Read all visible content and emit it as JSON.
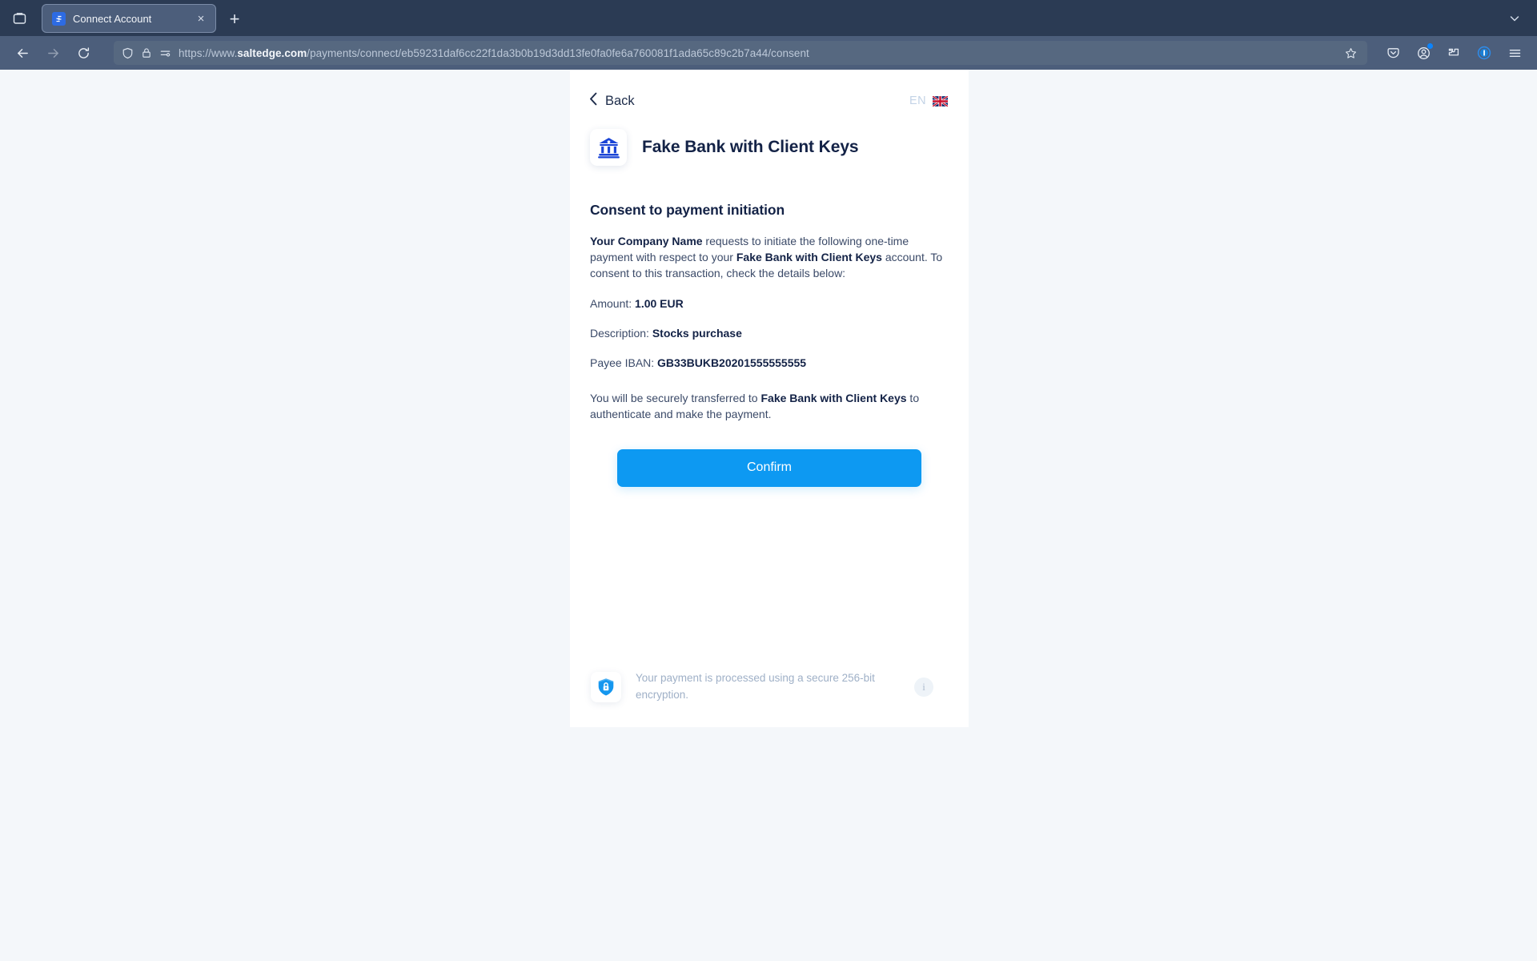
{
  "browser": {
    "tab": {
      "title": "Connect Account",
      "favicon_name": "saltedge-favicon",
      "close_label": "×"
    },
    "newtab_label": "+",
    "sidebar_icon": "sidebar-toggle-icon",
    "list_all_tabs_icon": "chevron-down-icon",
    "nav": {
      "back_icon": "back-arrow-icon",
      "forward_icon": "forward-arrow-icon",
      "reload_icon": "reload-icon"
    },
    "url": {
      "scheme_host_prefix": "https://www.",
      "host_bold": "saltedge.com",
      "path": "/payments/connect/eb59231daf6cc22f1da3b0b19d3dd13fe0fa0fe6a760081f1ada65c89c2b7a44/consent",
      "shield_icon": "tracking-protection-shield-icon",
      "lock_icon": "padlock-icon",
      "permissions_icon": "site-permissions-icon",
      "bookmark_icon": "bookmark-star-icon"
    },
    "toolbar": {
      "pocket": "save-to-pocket-icon",
      "account": "account-avatar-icon",
      "extensions": "extensions-icon",
      "container": "container-tabs-icon",
      "menu": "hamburger-menu-icon"
    }
  },
  "page": {
    "back_label": "Back",
    "back_icon": "chevron-left-icon",
    "language": {
      "code": "EN",
      "flag": "uk-flag-icon"
    },
    "bank": {
      "name": "Fake Bank with Client Keys",
      "logo_icon": "bank-building-icon"
    },
    "consent": {
      "title": "Consent to payment initiation",
      "intro_parts": {
        "company": "Your Company Name",
        "mid1": " requests to initiate the following one-time payment with respect to your ",
        "bank": "Fake Bank with Client Keys",
        "mid2": " account. To consent to this transaction, check the details below:"
      },
      "details": [
        {
          "label": "Amount: ",
          "value": "1.00 EUR"
        },
        {
          "label": "Description: ",
          "value": "Stocks purchase"
        },
        {
          "label": "Payee IBAN: ",
          "value": "GB33BUKB20201555555555"
        }
      ],
      "transfer_parts": {
        "pre": "You will be securely transferred to ",
        "bank": "Fake Bank with Client Keys",
        "post": " to authenticate and make the payment."
      },
      "confirm_label": "Confirm"
    },
    "footer": {
      "shield_icon": "secure-shield-lock-icon",
      "text": "Your payment is processed using a secure 256-bit encryption.",
      "info_label": "i",
      "info_icon": "info-icon"
    }
  },
  "colors": {
    "accent_blue": "#0d99f2",
    "brand_navy": "#132246",
    "bank_blue": "#1a44d6",
    "page_bg": "#f4f7fa",
    "chrome_dark": "#2b3b54",
    "chrome_nav": "#4c5e7b"
  }
}
